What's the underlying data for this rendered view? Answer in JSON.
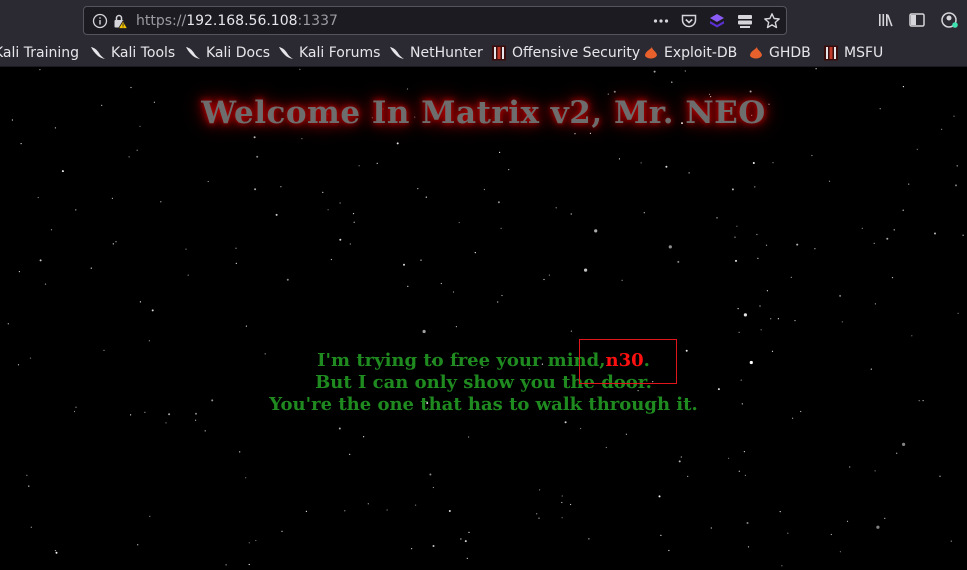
{
  "browser": {
    "url": {
      "scheme": "https://",
      "host": "192.168.56.108",
      "port": ":1337"
    },
    "bookmarks": [
      {
        "label": "Kali Training",
        "icon": "kali-dragon-icon"
      },
      {
        "label": "Kali Tools",
        "icon": "kali-dragon-icon"
      },
      {
        "label": "Kali Docs",
        "icon": "kali-dragon-icon"
      },
      {
        "label": "Kali Forums",
        "icon": "kali-dragon-icon"
      },
      {
        "label": "NetHunter",
        "icon": "kali-dragon-icon"
      },
      {
        "label": "Offensive Security",
        "icon": "offsec-icon"
      },
      {
        "label": "Exploit-DB",
        "icon": "exploitdb-icon"
      },
      {
        "label": "GHDB",
        "icon": "exploitdb-icon"
      },
      {
        "label": "MSFU",
        "icon": "offsec-icon"
      }
    ]
  },
  "page": {
    "heading": "Welcome In Matrix v2, Mr. NEO",
    "quote_line1_prefix": "I'm trying to free your mind,",
    "quote_line1_user": "n30",
    "quote_line1_suffix": ".",
    "quote_line2": "But I can only show you the door.",
    "quote_line3": "You're the one that has to walk through it."
  },
  "colors": {
    "background": "#000000",
    "heading": "#6d6d6d",
    "heading_glow": "#c00000",
    "quote": "#1f8a1f",
    "username": "#ff1010",
    "annotation_box": "#e0161a"
  }
}
